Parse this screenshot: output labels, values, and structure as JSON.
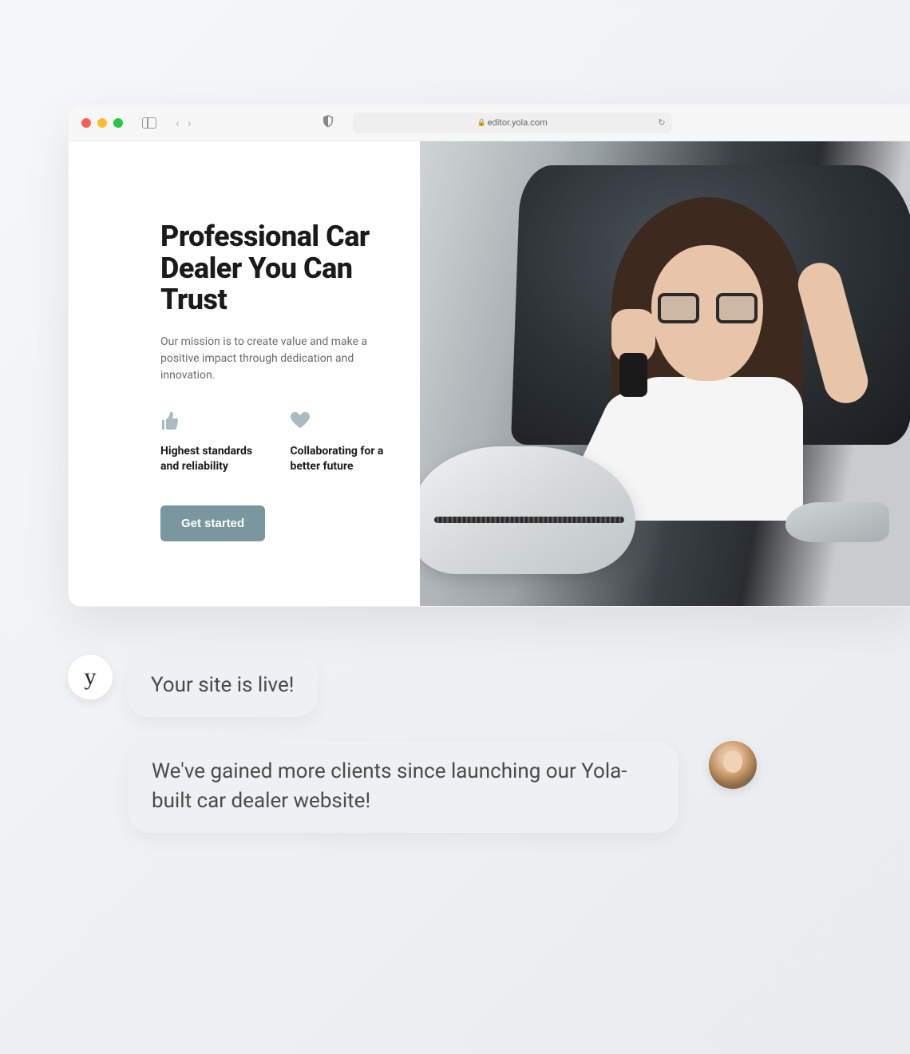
{
  "browser": {
    "url": "editor.yola.com"
  },
  "hero": {
    "title": "Professional Car Dealer You Can Trust",
    "subtitle": "Our mission is to create value and make a positive impact through dedication and innovation.",
    "features": [
      {
        "icon": "thumbs-up-icon",
        "text": "Highest standards and reliability"
      },
      {
        "icon": "heart-icon",
        "text": "Collaborating for a better future"
      }
    ],
    "cta_label": "Get started"
  },
  "chat": {
    "brand_avatar_letter": "y",
    "messages": [
      {
        "from": "brand",
        "text": "Your site is live!"
      },
      {
        "from": "user",
        "text": "We've gained more clients since launching our Yola-built car dealer website!"
      }
    ]
  }
}
